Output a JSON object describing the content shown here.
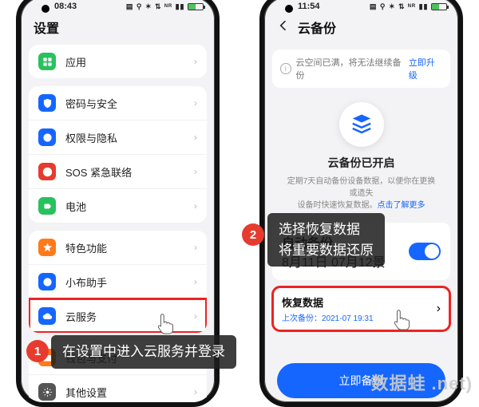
{
  "left": {
    "status_time": "08:43",
    "title": "设置",
    "groups": [
      [
        {
          "icon": "apps",
          "color": "#29c15e",
          "label": "应用"
        }
      ],
      [
        {
          "icon": "shield",
          "color": "#1566ff",
          "label": "密码与安全"
        },
        {
          "icon": "hand",
          "color": "#1566ff",
          "label": "权限与隐私"
        },
        {
          "icon": "sos",
          "color": "#e63b2e",
          "label": "SOS 紧急联络"
        },
        {
          "icon": "battery",
          "color": "#29c15e",
          "label": "电池"
        }
      ],
      [
        {
          "icon": "star",
          "color": "#ff7a1a",
          "label": "特色功能"
        },
        {
          "icon": "assist",
          "color": "#1566ff",
          "label": "小布助手"
        },
        {
          "icon": "cloud",
          "color": "#1566ff",
          "label": "云服务",
          "highlight": true
        }
      ],
      [
        {
          "icon": "wallet",
          "color": "#ff7a1a",
          "label": "钱包与支付"
        },
        {
          "icon": "gear",
          "color": "#555555",
          "label": "其他设置"
        }
      ]
    ]
  },
  "right": {
    "status_time": "11:54",
    "title": "云备份",
    "alert_text": "云空间已满，将无法继续备份",
    "alert_link": "立即升级",
    "section_title": "云备份已开启",
    "section_desc_a": "定期7天自动备份设备数据，以便你在更换或遗失",
    "section_desc_b": "设备时快速恢复数据。",
    "section_desc_link": "点击了解更多",
    "toggle_label": "自动备份",
    "toggle_sub": "8月11日 07月12景",
    "restore_title": "恢复数据",
    "restore_time": "上次备份：2021-07 19:31",
    "backup_btn": "立即备份"
  },
  "annotations": {
    "badge1": "1",
    "callout1": "在设置中进入云服务并登录",
    "badge2": "2",
    "callout2_line1": "选择恢复数据",
    "callout2_line2": "将重要数据还原"
  },
  "watermark": "数据蛙 .net)"
}
